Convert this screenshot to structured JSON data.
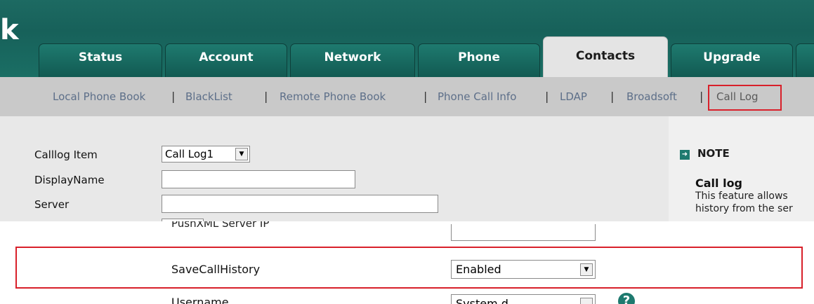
{
  "header": {
    "logo_text": "k"
  },
  "tabs": [
    {
      "label": "Status"
    },
    {
      "label": "Account"
    },
    {
      "label": "Network"
    },
    {
      "label": "Phone"
    },
    {
      "label": "Contacts",
      "active": true
    },
    {
      "label": "Upgrade"
    }
  ],
  "subnav": {
    "items": [
      {
        "label": "Local Phone Book"
      },
      {
        "label": "BlackList"
      },
      {
        "label": "Remote Phone Book"
      },
      {
        "label": "Phone Call Info"
      },
      {
        "label": "LDAP"
      },
      {
        "label": "Broadsoft"
      },
      {
        "label": "Call Log",
        "active": true
      }
    ],
    "separator": "|"
  },
  "form": {
    "calllog_item_label": "Calllog Item",
    "calllog_item_value": "Call Log1",
    "displayname_label": "DisplayName",
    "displayname_value": "",
    "server_label": "Server",
    "server_value": ""
  },
  "note": {
    "icon": "arrow-right-square-icon",
    "title": "NOTE",
    "subtitle": "Call log",
    "lines": [
      "This feature allows",
      "history from the ser"
    ]
  },
  "settings": {
    "partial_top_label": "PushXML Server IP",
    "save_call_history_label": "SaveCallHistory",
    "save_call_history_value": "Enabled",
    "partial_bottom_label": "Username",
    "partial_bottom_value": "System d",
    "help_icon": "question-circle-icon"
  },
  "colors": {
    "header_teal": "#1a6e64",
    "highlight_red": "#d8202a",
    "sublink_color": "#5d6f89"
  }
}
